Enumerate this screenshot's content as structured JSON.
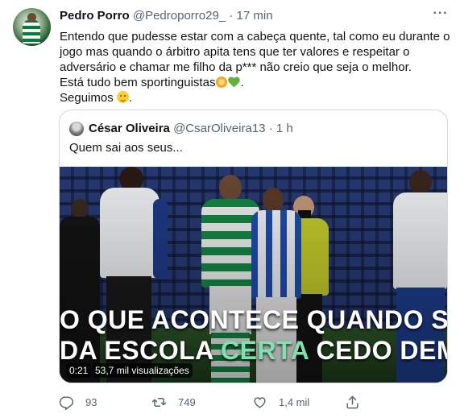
{
  "author": {
    "name": "Pedro Porro",
    "handle": "@Pedroporro29_",
    "separator": "·",
    "time": "17 min"
  },
  "tweet": {
    "lines": [
      "Entendo que pudesse estar com a cabeça quente, tal como eu durante o",
      "jogo mas quando o árbitro apita tens que ter valores e respeitar o",
      "adversário e chamar me filho da p*** não creio que seja o melhor.",
      "Está tudo bem sportinguistas",
      "Seguimos "
    ],
    "line4_suffix": ".",
    "line5_suffix": "."
  },
  "quoted": {
    "name": "César Oliveira",
    "handle": "@CsarOliveira13",
    "separator": "·",
    "time": "1 h",
    "text": "Quem sai aos seus...",
    "video": {
      "caption_line1": "O QUE ACONTECE QUANDO SE SAI",
      "caption_line2_a": "DA ESCOLA ",
      "caption_line2_highlight": "CERTA",
      "caption_line2_b": " CEDO DEMAIS",
      "timestamp": "0:21",
      "views": "53,7 mil visualizações"
    }
  },
  "actions": {
    "replies": "93",
    "retweets": "749",
    "likes": "1,4 mil"
  },
  "colors": {
    "text": "#0f1419",
    "secondary": "#536471",
    "border": "#cfd9de",
    "caption_highlight": "#7fe0b0"
  },
  "icons": [
    "more-icon",
    "lion-emoji",
    "green-heart-emoji",
    "wink-emoji",
    "reply-icon",
    "retweet-icon",
    "like-icon",
    "share-icon"
  ]
}
